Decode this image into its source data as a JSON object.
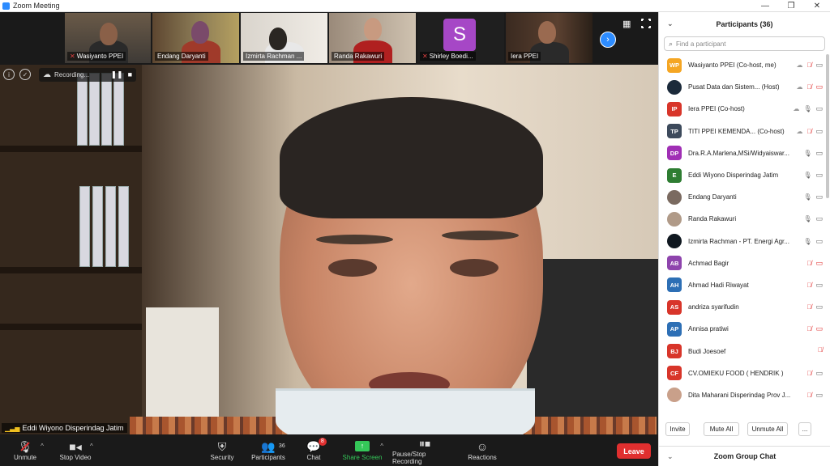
{
  "window": {
    "title": "Zoom Meeting",
    "controls": [
      "—",
      "❐",
      "✕"
    ]
  },
  "thumbnails": [
    {
      "name": "Wasiyanto PPEI",
      "muted": true,
      "type": "video"
    },
    {
      "name": "Endang Daryanti",
      "muted": false,
      "type": "video"
    },
    {
      "name": "Izmirta Rachman ...",
      "muted": false,
      "type": "video"
    },
    {
      "name": "Randa Rakawuri",
      "muted": false,
      "type": "video"
    },
    {
      "name": "Shirley Boedi...",
      "muted": true,
      "type": "letter",
      "letter": "S"
    },
    {
      "name": "Iera PPEI",
      "muted": false,
      "type": "video"
    }
  ],
  "recording": {
    "label": "Recording...",
    "pause_icon": "❚❚",
    "stop_icon": "■"
  },
  "speaker": {
    "name": "Eddi Wiyono Disperindag Jatim"
  },
  "toolbar": {
    "unmute": "Unmute",
    "stop_video": "Stop Video",
    "security": "Security",
    "participants": "Participants",
    "participants_count": "36",
    "chat": "Chat",
    "chat_badge": "8",
    "share_screen": "Share Screen",
    "recording": "Pause/Stop Recording",
    "reactions": "Reactions",
    "leave": "Leave"
  },
  "panel": {
    "title": "Participants (36)",
    "search_placeholder": "Find a participant",
    "participants": [
      {
        "initials": "WP",
        "color": "#f5a623",
        "name": "Wasiyanto PPEI (Co-host, me)",
        "cloud": true,
        "mic": "off",
        "video": "on"
      },
      {
        "initials": "",
        "color": "#1b2a3a",
        "name": "Pusat Data dan Sistem... (Host)",
        "cloud": true,
        "mic": "off",
        "video": "off",
        "photo": true
      },
      {
        "initials": "IP",
        "color": "#d8352a",
        "name": "Iera PPEI (Co-host)",
        "cloud": true,
        "mic": "on",
        "video": "on"
      },
      {
        "initials": "TP",
        "color": "#3d4a5c",
        "name": "TITI PPEI KEMENDA...   (Co-host)",
        "cloud": true,
        "mic": "off",
        "video": "on"
      },
      {
        "initials": "DP",
        "color": "#a02fb5",
        "name": "Dra.R.A.Marlena,MSi/Widyaiswar...",
        "cloud": false,
        "mic": "on",
        "video": "on"
      },
      {
        "initials": "E",
        "color": "#2e7d32",
        "name": "Eddi Wiyono Disperindag Jatim",
        "cloud": false,
        "mic": "on",
        "video": "on"
      },
      {
        "initials": "",
        "color": "#7a6a60",
        "name": "Endang Daryanti",
        "cloud": false,
        "mic": "on",
        "video": "on",
        "photo": true
      },
      {
        "initials": "",
        "color": "#b09a88",
        "name": "Randa Rakawuri",
        "cloud": false,
        "mic": "on",
        "video": "on",
        "photo": true
      },
      {
        "initials": "",
        "color": "#101820",
        "name": "Izmirta Rachman - PT. Energi Agr...",
        "cloud": false,
        "mic": "on",
        "video": "on",
        "photo": true
      },
      {
        "initials": "AB",
        "color": "#8e44ad",
        "name": "Achmad Bagir",
        "cloud": false,
        "mic": "off",
        "video": "off"
      },
      {
        "initials": "AH",
        "color": "#2d6fb5",
        "name": "Ahmad Hadi Riwayat",
        "cloud": false,
        "mic": "off",
        "video": "on"
      },
      {
        "initials": "AS",
        "color": "#d8352a",
        "name": "andriza syarifudin",
        "cloud": false,
        "mic": "off",
        "video": "on"
      },
      {
        "initials": "AP",
        "color": "#2d6fb5",
        "name": "Annisa pratiwi",
        "cloud": false,
        "mic": "off",
        "video": "off"
      },
      {
        "initials": "BJ",
        "color": "#d8352a",
        "name": "Budi Joesoef",
        "cloud": false,
        "mic": "off",
        "video": "none"
      },
      {
        "initials": "CF",
        "color": "#d8352a",
        "name": "CV.OMIEKU FOOD ( HENDRIK )",
        "cloud": false,
        "mic": "off",
        "video": "on"
      },
      {
        "initials": "",
        "color": "#c9a08a",
        "name": "Dita Maharani Disperindag Prov J...",
        "cloud": false,
        "mic": "off",
        "video": "on",
        "photo": true
      }
    ],
    "invite": "Invite",
    "mute_all": "Mute All",
    "unmute_all": "Unmute All",
    "more": "...",
    "group_chat": "Zoom Group Chat"
  },
  "colors": {
    "accent": "#2d8cff",
    "danger": "#e02f2f",
    "share": "#35c759"
  }
}
